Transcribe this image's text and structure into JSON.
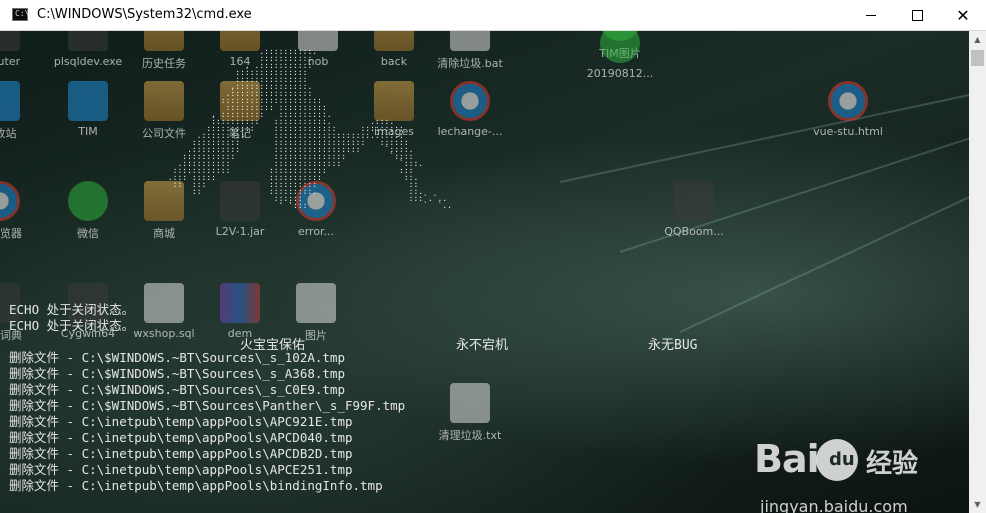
{
  "window": {
    "title": "C:\\WINDOWS\\System32\\cmd.exe",
    "app_icon_glyph": "C:\\",
    "minimize_glyph": "",
    "maximize_glyph": "",
    "close_glyph": "✕"
  },
  "desktop": {
    "items": [
      {
        "label": "mputer",
        "icon": "computer-icon"
      },
      {
        "label": "plsqldev.exe",
        "icon": "plsqldev-icon"
      },
      {
        "label": "历史任务",
        "icon": "folder-icon"
      },
      {
        "label": "164",
        "icon": "folder-icon"
      },
      {
        "label": "nob",
        "icon": "file-icon"
      },
      {
        "label": "back",
        "icon": "folder-icon"
      },
      {
        "label": "清除垃圾.bat",
        "icon": "bat-file-icon"
      },
      {
        "label": "TIM图片",
        "icon": "image-icon"
      },
      {
        "label": "20190812...",
        "icon": "image-icon"
      },
      {
        "label": "回收站",
        "icon": "recycle-bin-icon"
      },
      {
        "label": "TIM",
        "icon": "tim-icon"
      },
      {
        "label": "公司文件",
        "icon": "folder-icon"
      },
      {
        "label": "笔记",
        "icon": "folder-icon"
      },
      {
        "label": "images",
        "icon": "folder-icon"
      },
      {
        "label": "lechange-...",
        "icon": "ie-icon"
      },
      {
        "label": "vue-stu.html",
        "icon": "ie-icon"
      },
      {
        "label": "览浏览器",
        "icon": "ie-icon"
      },
      {
        "label": "微信",
        "icon": "wechat-icon"
      },
      {
        "label": "商城",
        "icon": "folder-icon"
      },
      {
        "label": "L2V-1.jar",
        "icon": "jar-icon"
      },
      {
        "label": "error...",
        "icon": "ie-icon"
      },
      {
        "label": "QQBoom...",
        "icon": "qqboom-icon"
      },
      {
        "label": "有道词典",
        "icon": "youdao-icon"
      },
      {
        "label": "Cygwin64",
        "icon": "cygwin-icon"
      },
      {
        "label": "wxshop.sql",
        "icon": "sql-file-icon"
      },
      {
        "label": "dem",
        "icon": "winrar-icon"
      },
      {
        "label": "图片",
        "icon": "file-icon"
      },
      {
        "label": "清理垃圾.txt",
        "icon": "txt-file-icon"
      }
    ]
  },
  "console": {
    "ascii_art": [
      "                    .::::::::::.",
      "                    :::::::::::",
      "                 , .:::::::::::",
      "               :::::::::::::::",
      "               :::::::::::::::",
      "              ,:::::::::::::::.",
      "             .:::::::::::::::::",
      "            :::::::::::::::::::::",
      "             :::::::::: ::::::::::",
      "          , :::::::::   ::::::::::.",
      "          ::::::::::   :::::::::::.        .:::.",
      "         ::::::::::    :::::::::::::     :::::::::",
      "       .:::::::::      ::::::::::::::::::::.::::::",
      "      ::::::::::       :::::::::::::::::::   ::::::",
      "     .::::::::::       ::::::::::::::::::     `::::.",
      "    :::::::::::        :::::::::::::::         `::::",
      "   .::::::::::         ::::::::::::::            `:::.",
      "  ::::::::::::        ::::::::::::               :::",
      " .::: :::::           :::::::::::                 ::.",
      "  ::  :::             ::::::::::                   ::",
      "      ::              :::::::::.                   ::.",
      "                       ::::::                      :::`.`..",
      "                        ' ':::                        `  `.."
    ],
    "echo_off_1": "ECHO 处于关闭状态。",
    "echo_off_2": "ECHO 处于关闭状态。",
    "blessings": [
      "火宝宝保佑",
      "永不宕机",
      "永无BUG"
    ],
    "delete_prefix": "删除文件 - ",
    "deleted_files": [
      "C:\\$WINDOWS.~BT\\Sources\\_s_102A.tmp",
      "C:\\$WINDOWS.~BT\\Sources\\_s_A368.tmp",
      "C:\\$WINDOWS.~BT\\Sources\\_s_C0E9.tmp",
      "C:\\$WINDOWS.~BT\\Sources\\Panther\\_s_F99F.tmp",
      "C:\\inetpub\\temp\\appPools\\APC921E.tmp",
      "C:\\inetpub\\temp\\appPools\\APCD040.tmp",
      "C:\\inetpub\\temp\\appPools\\APCDB2D.tmp",
      "C:\\inetpub\\temp\\appPools\\APCE251.tmp",
      "C:\\inetpub\\temp\\appPools\\bindingInfo.tmp"
    ]
  },
  "scrollbar": {
    "up_glyph": "▲",
    "down_glyph": "▼"
  },
  "watermark": {
    "logo_text": "Bai",
    "paw_text": "du",
    "cn_text": "经验",
    "url": "jingyan.baidu.com"
  }
}
